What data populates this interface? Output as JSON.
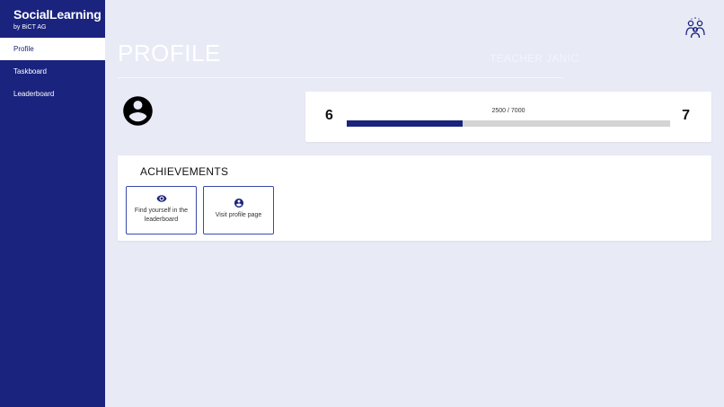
{
  "sidebar": {
    "brand_title": "SocialLearning",
    "brand_subtitle": "by BiCT AG",
    "items": [
      {
        "label": "Profile",
        "active": true
      },
      {
        "label": "Taskboard",
        "active": false
      },
      {
        "label": "Leaderboard",
        "active": false
      }
    ]
  },
  "header": {
    "title": "PROFILE",
    "username": "TEACHER JANIC",
    "logo_icon": "team-logo-icon"
  },
  "profile": {
    "avatar_icon": "account-circle-icon",
    "level_current": "6",
    "level_next": "7",
    "progress_text": "2500 / 7000",
    "progress_fraction": 0.357
  },
  "achievements": {
    "title": "ACHIEVEMENTS",
    "items": [
      {
        "label": "Find yourself in the leaderboard",
        "icon": "eye-icon"
      },
      {
        "label": "Visit profile page",
        "icon": "account-circle-icon"
      }
    ]
  },
  "colors": {
    "primary": "#1a237e",
    "background": "#e8eaf6",
    "track": "#d4d4d4"
  }
}
